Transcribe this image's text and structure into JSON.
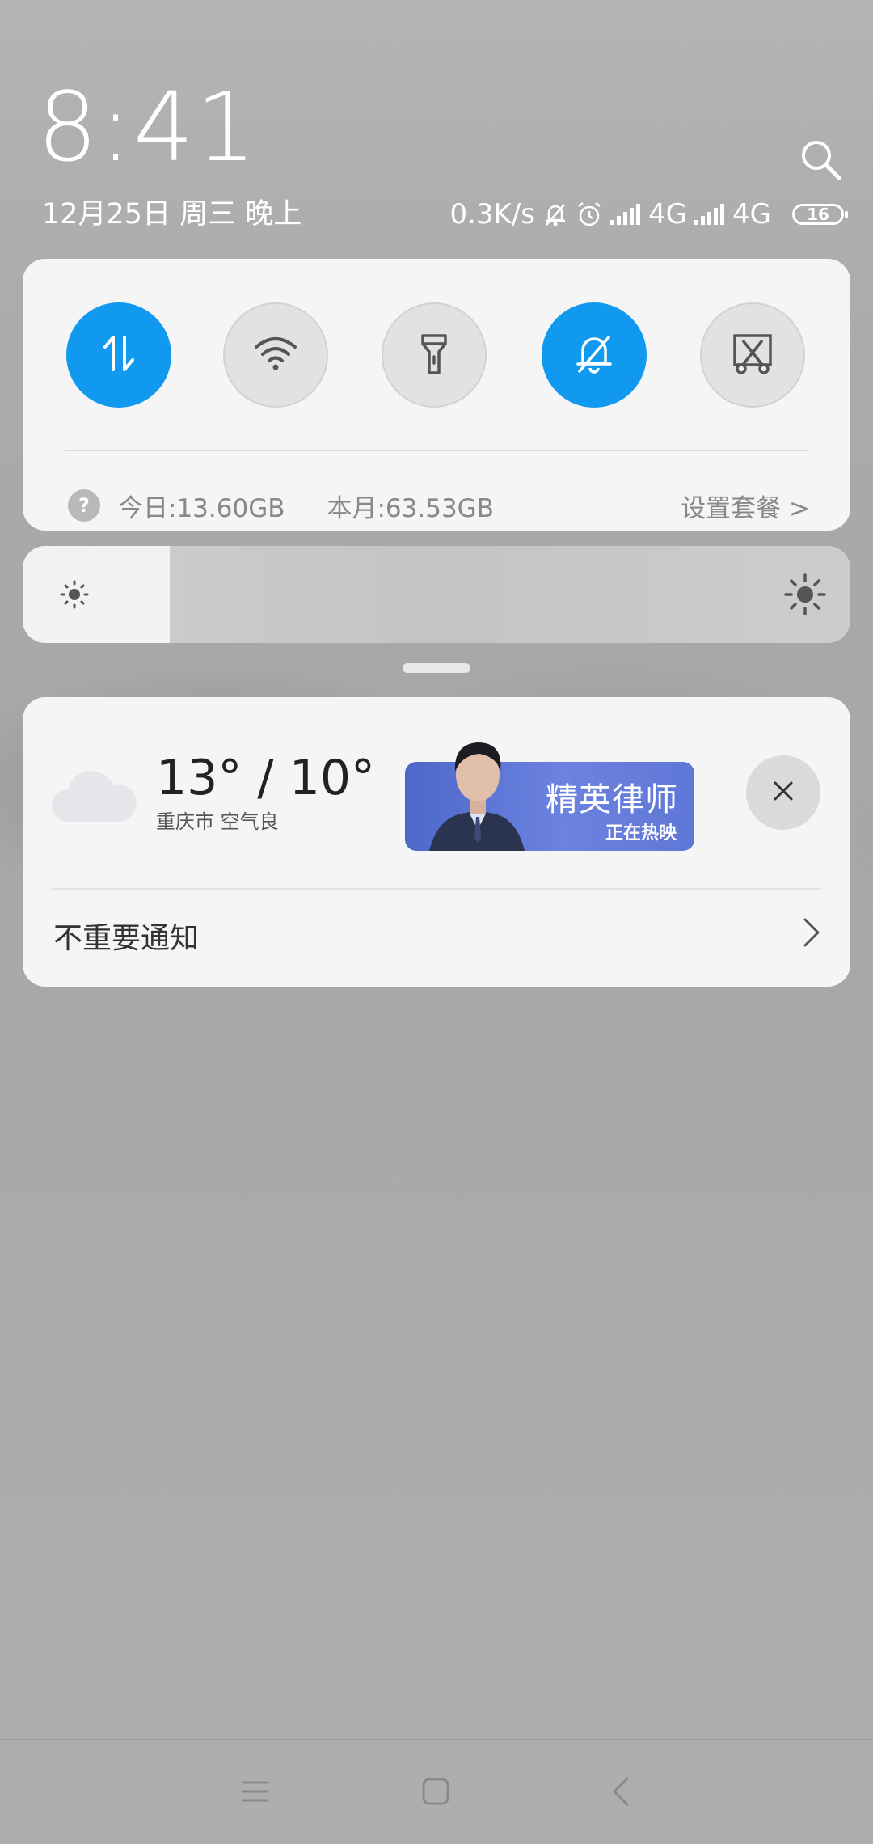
{
  "header": {
    "time": "8:41",
    "date": "12月25日 周三 晚上",
    "net_speed": "0.3K/s",
    "network_1": "4G",
    "network_2": "4G",
    "battery": "16"
  },
  "quick_toggles": [
    {
      "name": "mobile-data",
      "state": "on"
    },
    {
      "name": "wifi",
      "state": "off"
    },
    {
      "name": "flashlight",
      "state": "off"
    },
    {
      "name": "silent-mode",
      "state": "on"
    },
    {
      "name": "screenshot",
      "state": "off"
    }
  ],
  "data_usage": {
    "today": "今日:13.60GB",
    "month": "本月:63.53GB",
    "plan_link": "设置套餐 >"
  },
  "brightness": {
    "level": 0.15
  },
  "weather": {
    "temperature": "13° / 10°",
    "location_quality": "重庆市  空气良"
  },
  "banner": {
    "title": "精英律师",
    "subtitle": "正在热映"
  },
  "notifications": {
    "unimportant_label": "不重要通知"
  },
  "colors": {
    "accent": "#1199f0"
  }
}
